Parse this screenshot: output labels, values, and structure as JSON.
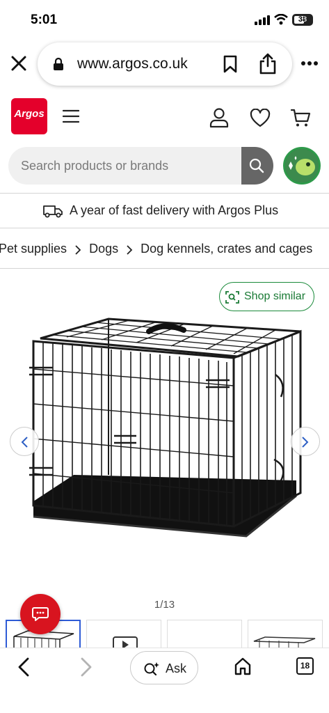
{
  "status_bar": {
    "time": "5:01",
    "battery": "38"
  },
  "browser": {
    "url": "www.argos.co.uk",
    "ask_label": "Ask",
    "tab_count": "18"
  },
  "header": {
    "logo_text": "Argos",
    "search_placeholder": "Search products or brands"
  },
  "delivery_banner": {
    "text": "A year of fast delivery with Argos Plus"
  },
  "breadcrumb": {
    "items": [
      "Pet supplies",
      "Dogs",
      "Dog kennels, crates and cages"
    ]
  },
  "gallery": {
    "shop_similar_label": "Shop similar",
    "counter": "1/13"
  },
  "colors": {
    "brand_red": "#e4002b",
    "shop_similar_green": "#1a8a3a",
    "active_thumb_blue": "#2e5bd6"
  },
  "icons": [
    "close-icon",
    "lock-icon",
    "bookmark-icon",
    "share-icon",
    "more-icon",
    "menu-icon",
    "account-icon",
    "heart-icon",
    "basket-icon",
    "search-icon",
    "van-icon",
    "chevron-right-icon",
    "visual-search-icon",
    "chevron-left-icon",
    "chat-icon",
    "back-icon",
    "forward-icon",
    "ask-sparkle-icon",
    "home-icon"
  ]
}
